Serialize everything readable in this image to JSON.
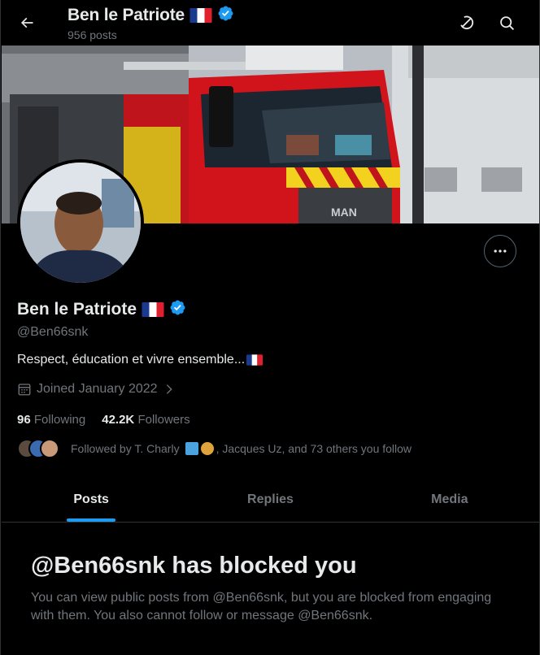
{
  "header": {
    "title": "Ben le Patriote",
    "posts_count": "956 posts"
  },
  "icons": {
    "back": "arrow-left-icon",
    "grok": "grok-icon",
    "search": "search-icon",
    "more": "more-icon",
    "calendar": "calendar-icon",
    "chevron": "chevron-right-icon",
    "verified": "verified-badge-icon",
    "flag": "france-flag-icon"
  },
  "profile": {
    "name": "Ben le Patriote",
    "handle": "@Ben66snk",
    "bio": "Respect, éducation et vivre ensemble...",
    "joined": "Joined January 2022",
    "following_count": "96",
    "following_label": "Following",
    "followers_count": "42.2K",
    "followers_label": "Followers",
    "followed_by_prefix": "Followed by T. Charly",
    "followed_by_suffix": ", Jacques Uz, and 73 others you follow"
  },
  "tabs": [
    {
      "label": "Posts",
      "active": true
    },
    {
      "label": "Replies",
      "active": false
    },
    {
      "label": "Media",
      "active": false
    }
  ],
  "blocked": {
    "title": "@Ben66snk has blocked you",
    "text": "You can view public posts from @Ben66snk, but you are blocked from engaging with them. You also cannot follow or message @Ben66snk."
  },
  "colors": {
    "accent": "#1d9bf0",
    "background": "#000000",
    "secondary_text": "#71767b",
    "border": "#2f3336"
  }
}
